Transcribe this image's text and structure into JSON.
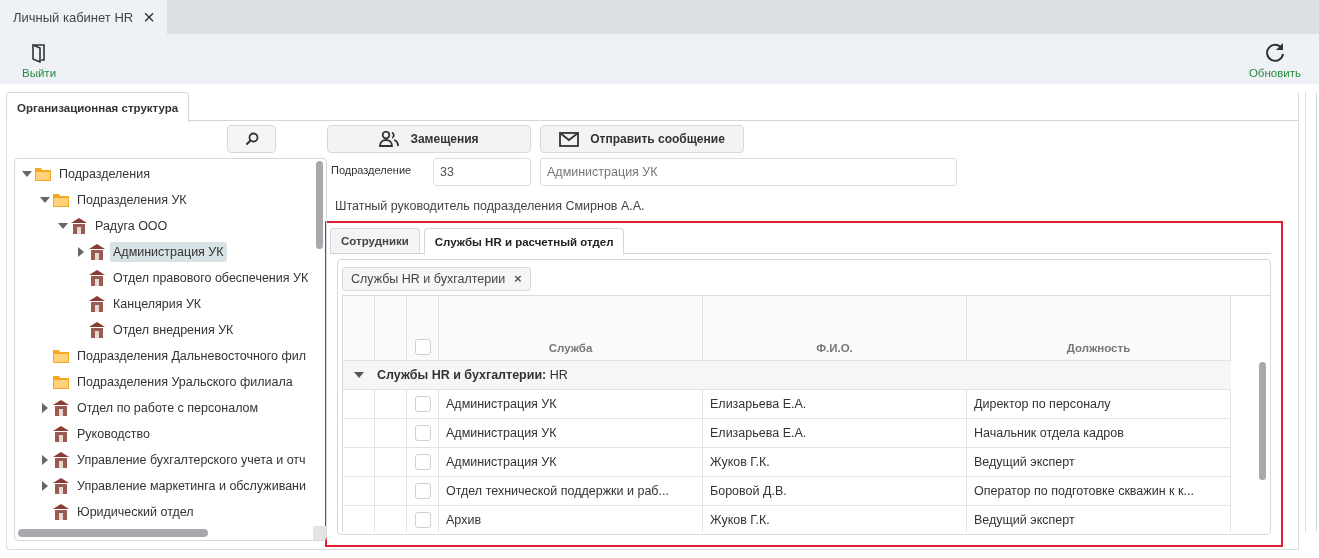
{
  "window_tab": {
    "title": "Личный кабинет HR",
    "close": "×"
  },
  "toolbar": {
    "exit": "Выйти",
    "refresh": "Обновить"
  },
  "panel_tab": {
    "label": "Организационная структура",
    "selected": true
  },
  "tree": [
    {
      "label": "Подразделения",
      "kind": "folder",
      "expanded": true,
      "selected": false,
      "children": [
        {
          "label": "Подразделения УК",
          "kind": "folder",
          "expanded": true,
          "selected": false,
          "children": [
            {
              "label": "Радуга ООО",
              "kind": "unit",
              "expanded": true,
              "selected": false,
              "children": [
                {
                  "label": "Администрация УК",
                  "kind": "unit",
                  "expanded": false,
                  "selected": true
                },
                {
                  "label": "Отдел правового обеспечения УК",
                  "kind": "unit",
                  "selected": false
                },
                {
                  "label": "Канцелярия УК",
                  "kind": "unit",
                  "selected": false
                },
                {
                  "label": "Отдел внедрения УК",
                  "kind": "unit",
                  "selected": false
                }
              ]
            }
          ]
        },
        {
          "label": "Подразделения Дальневосточного фил",
          "kind": "folder",
          "selected": false
        },
        {
          "label": "Подразделения Уральского филиала",
          "kind": "folder",
          "selected": false
        },
        {
          "label": "Отдел по работе с персоналом",
          "kind": "unit",
          "expanded": false,
          "selected": false
        },
        {
          "label": "Руководство",
          "kind": "unit",
          "selected": false
        },
        {
          "label": "Управление бухгалтерского учета и отч",
          "kind": "unit",
          "expanded": false,
          "selected": false
        },
        {
          "label": "Управление маркетинга и обслуживани",
          "kind": "unit",
          "expanded": false,
          "selected": false
        },
        {
          "label": "Юридический отдел",
          "kind": "unit",
          "selected": false
        }
      ]
    }
  ],
  "actions": [
    "Замещения",
    "Отправить сообщение"
  ],
  "unit": {
    "label": "Подразделение",
    "code": "33",
    "name": "Администрация УК"
  },
  "manager_line": "Штатный руководитель подразделения Смирнов А.А.",
  "tabs": [
    {
      "label": "Сотрудники",
      "selected": false
    },
    {
      "label": "Службы HR и расчетный отдел",
      "selected": true
    }
  ],
  "filter_chip": {
    "label": "Службы HR и бухгалтерии",
    "remove": "×"
  },
  "table": {
    "header_checked": false,
    "columns": [
      "Служба",
      "Ф.И.О.",
      "Должность"
    ],
    "group": {
      "label": "**Службы HR и бухгалтерии:** HR",
      "expanded": true
    },
    "rows": [
      {
        "checked": false,
        "cells": [
          "Администрация УК",
          "Елизарьева Е.А.",
          "Директор по персоналу"
        ]
      },
      {
        "checked": false,
        "cells": [
          "Администрация УК",
          "Елизарьева Е.А.",
          "Начальник отдела кадров"
        ]
      },
      {
        "checked": false,
        "cells": [
          "Администрация УК",
          "Жуков Г.К.",
          "Ведущий эксперт"
        ]
      },
      {
        "checked": false,
        "cells": [
          "Отдел технической поддержки и раб...",
          "Боровой Д.В.",
          "Оператор по подготовке скважин к к..."
        ]
      },
      {
        "checked": false,
        "cells": [
          "Архив",
          "Жуков Г.К.",
          "Ведущий эксперт"
        ]
      }
    ]
  }
}
